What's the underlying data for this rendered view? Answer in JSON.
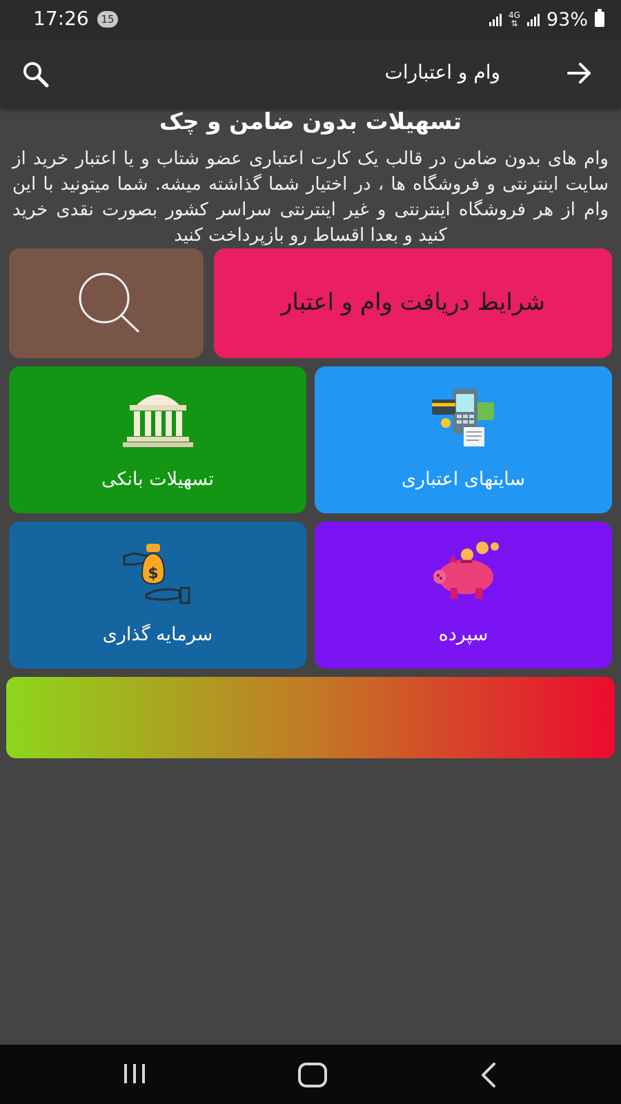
{
  "status_bar": {
    "time": "17:26",
    "notification_count": "15",
    "network": "4G",
    "battery": "93%"
  },
  "app_bar": {
    "title": "وام و اعتبارات",
    "back_icon": "arrow-right-icon",
    "search_icon": "search-icon"
  },
  "headline": "تسهیلات بدون ضامن و چک",
  "description": "وام های بدون ضامن در قالب یک کارت اعتباری عضو شتاب و یا اعتبار خرید از سایت اینترنتی و فروشگاه ها ، در اختیار شما گذاشته میشه. شما میتونید با این وام از هر فروشگاه اینترنتی و غیر اینترنتی سراسر کشور بصورت نقدی خرید کنید و بعدا اقساط رو  بازپرداخت کنید",
  "tiles": {
    "search": {
      "icon": "magnifier-icon",
      "color": "#795548"
    },
    "conditions": {
      "label": "شرایط دریافت وام و اعتبار",
      "color": "#e91e63"
    },
    "bank": {
      "label": "تسهیلات بانکی",
      "icon": "bank-building-icon",
      "color": "#139613"
    },
    "credit_sites": {
      "label": "سایتهای اعتباری",
      "icon": "payment-terminal-icon",
      "color": "#2196f3"
    },
    "investment": {
      "label": "سرمایه گذاری",
      "icon": "money-bag-hand-icon",
      "color": "#1565a0"
    },
    "deposit": {
      "label": "سپرده",
      "icon": "piggy-bank-icon",
      "color": "#7a14f2"
    }
  },
  "banner": {
    "gradient": [
      "#8ed61b",
      "#c27a25",
      "#ed0a30"
    ]
  },
  "nav_bar": {
    "icons": [
      "recents-icon",
      "home-icon",
      "back-icon"
    ]
  }
}
